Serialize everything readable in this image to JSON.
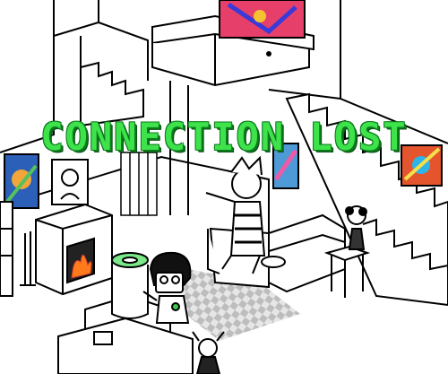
{
  "game": {
    "status_message": "CONNECTION LOST"
  },
  "scene": {
    "objects": [
      "bathtub",
      "staircase-right",
      "staircase-left",
      "fireplace",
      "fire",
      "portrait-frame",
      "painting-top",
      "painting-left",
      "painting-right",
      "painting-center",
      "window-blinds",
      "armchair-with-jester",
      "couch",
      "side-table",
      "flower-vase",
      "checkered-rug",
      "player-character",
      "cruxtruder-machine",
      "pogo-jester-doll"
    ]
  },
  "colors": {
    "banner_fill": "#3ee34b",
    "banner_outline": "#0c7a1c",
    "fire": "#ff7a1a",
    "cruxtruder_lid": "#7be88a",
    "rug_dark": "#bdbdbd",
    "rug_light": "#e6e6e6",
    "line": "#000000"
  }
}
